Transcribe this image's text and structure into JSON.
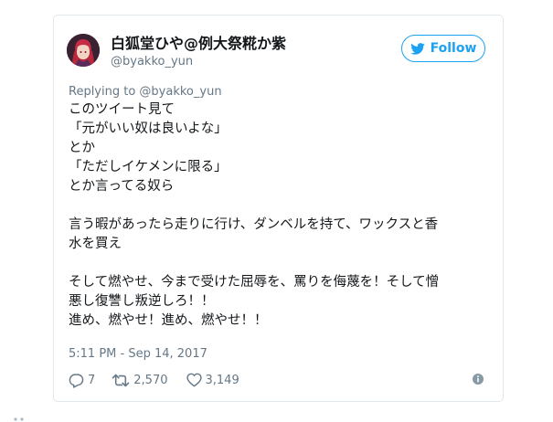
{
  "tweet": {
    "author": {
      "display_name": "白狐堂ひや@例大祭糀か紫",
      "handle": "@byakko_yun"
    },
    "follow_label": "Follow",
    "reply_context": "Replying to @byakko_yun",
    "text_lines": [
      "このツイート見て",
      "「元がいい奴は良いよな」",
      "とか",
      "「ただしイケメンに限る」",
      "とか言ってる奴ら",
      "",
      "言う暇があったら走りに行け、ダンベルを持て、ワックスと香",
      "水を買え",
      "",
      "そして燃やせ、今まで受けた屈辱を、罵りを侮蔑を！そして憎",
      "悪し復讐し叛逆しろ！！",
      "進め、燃やせ！進め、燃やせ！！"
    ],
    "timestamp": "5:11 PM - Sep 14, 2017",
    "stats": {
      "replies": "7",
      "retweets": "2,570",
      "likes": "3,149"
    }
  },
  "icons": {
    "follow": "twitter-bird-icon",
    "reply": "reply-icon",
    "retweet": "retweet-icon",
    "like": "heart-icon",
    "info": "info-icon"
  },
  "colors": {
    "accent": "#1da1f2",
    "muted": "#657786",
    "text": "#14171a",
    "border": "#e1e8ed"
  }
}
